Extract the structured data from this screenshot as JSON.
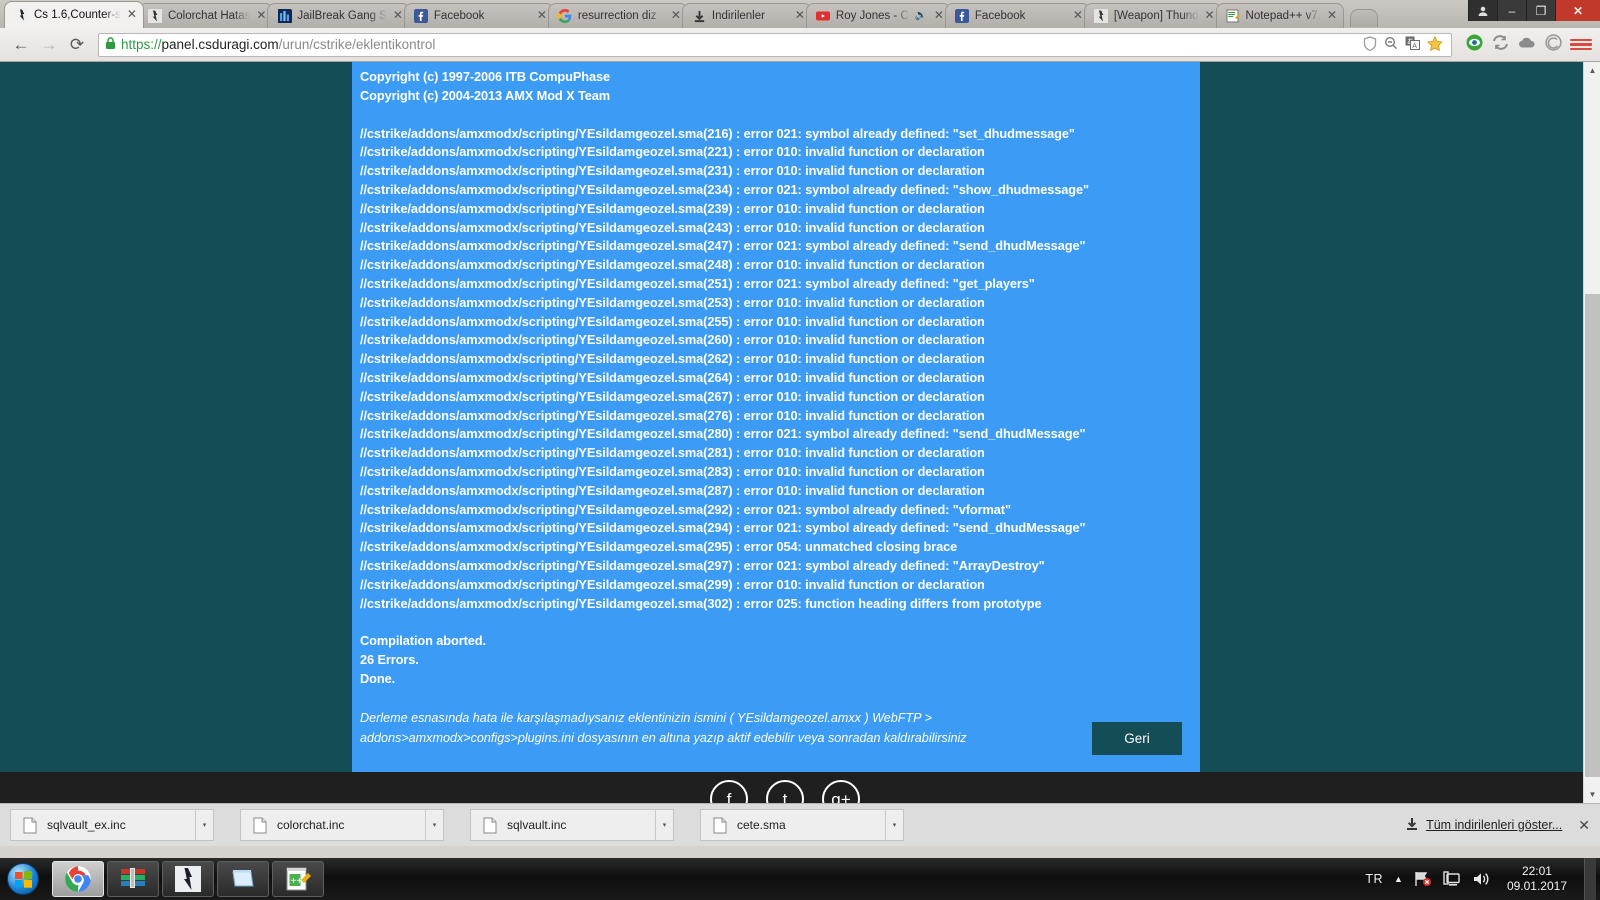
{
  "window": {
    "controls": {
      "user": "user-icon",
      "minimize": "–",
      "restore": "❐",
      "close": "✕"
    }
  },
  "tabs": [
    {
      "label": "Cs 1.6,Counter-s",
      "favicon": "cs-icon",
      "active": true,
      "close": "✕"
    },
    {
      "label": "Colorchat Hatas",
      "favicon": "cs-icon",
      "active": false,
      "close": "✕"
    },
    {
      "label": "JailBreak Gang S",
      "favicon": "forum-icon",
      "active": false,
      "close": "✕"
    },
    {
      "label": "Facebook",
      "favicon": "facebook-icon",
      "active": false,
      "close": "✕"
    },
    {
      "label": "resurrection diz",
      "favicon": "google-icon",
      "active": false,
      "close": "✕"
    },
    {
      "label": "İndirilenler",
      "favicon": "download-icon",
      "active": false,
      "close": "✕"
    },
    {
      "label": "Roy Jones - C",
      "favicon": "youtube-icon",
      "active": false,
      "close": "✕",
      "audio": "speaker-icon"
    },
    {
      "label": "Facebook",
      "favicon": "facebook-icon",
      "active": false,
      "close": "✕"
    },
    {
      "label": "[Weapon] Thund",
      "favicon": "cs-icon",
      "active": false,
      "close": "✕"
    },
    {
      "label": "Notepad++ v7.",
      "favicon": "notepad-icon",
      "active": false,
      "close": "✕"
    }
  ],
  "toolbar": {
    "back": "←",
    "forward": "→",
    "reload": "⟳",
    "lock": "lock-icon",
    "url_scheme": "https://",
    "url_host": "panel.csduragi.com",
    "url_path": "/urun/cstrike/eklentikontrol",
    "omnibox_icons": [
      "shield-icon",
      "zoom-out-icon",
      "translate-icon",
      "bookmark-star-icon"
    ],
    "extensions": [
      "adblock-icon",
      "sync-icon",
      "cloud-icon",
      "spiral-icon"
    ],
    "menu": "chrome-menu-icon"
  },
  "page": {
    "header_lines": [
      "Copyright (c) 1997-2006 ITB CompuPhase",
      "Copyright (c) 2004-2013 AMX Mod X Team"
    ],
    "errors": [
      "//cstrike/addons/amxmodx/scripting/YEsildamgeozel.sma(216) : error 021: symbol already defined: \"set_dhudmessage\"",
      "//cstrike/addons/amxmodx/scripting/YEsildamgeozel.sma(221) : error 010: invalid function or declaration",
      "//cstrike/addons/amxmodx/scripting/YEsildamgeozel.sma(231) : error 010: invalid function or declaration",
      "//cstrike/addons/amxmodx/scripting/YEsildamgeozel.sma(234) : error 021: symbol already defined: \"show_dhudmessage\"",
      "//cstrike/addons/amxmodx/scripting/YEsildamgeozel.sma(239) : error 010: invalid function or declaration",
      "//cstrike/addons/amxmodx/scripting/YEsildamgeozel.sma(243) : error 010: invalid function or declaration",
      "//cstrike/addons/amxmodx/scripting/YEsildamgeozel.sma(247) : error 021: symbol already defined: \"send_dhudMessage\"",
      "//cstrike/addons/amxmodx/scripting/YEsildamgeozel.sma(248) : error 010: invalid function or declaration",
      "//cstrike/addons/amxmodx/scripting/YEsildamgeozel.sma(251) : error 021: symbol already defined: \"get_players\"",
      "//cstrike/addons/amxmodx/scripting/YEsildamgeozel.sma(253) : error 010: invalid function or declaration",
      "//cstrike/addons/amxmodx/scripting/YEsildamgeozel.sma(255) : error 010: invalid function or declaration",
      "//cstrike/addons/amxmodx/scripting/YEsildamgeozel.sma(260) : error 010: invalid function or declaration",
      "//cstrike/addons/amxmodx/scripting/YEsildamgeozel.sma(262) : error 010: invalid function or declaration",
      "//cstrike/addons/amxmodx/scripting/YEsildamgeozel.sma(264) : error 010: invalid function or declaration",
      "//cstrike/addons/amxmodx/scripting/YEsildamgeozel.sma(267) : error 010: invalid function or declaration",
      "//cstrike/addons/amxmodx/scripting/YEsildamgeozel.sma(276) : error 010: invalid function or declaration",
      "//cstrike/addons/amxmodx/scripting/YEsildamgeozel.sma(280) : error 021: symbol already defined: \"send_dhudMessage\"",
      "//cstrike/addons/amxmodx/scripting/YEsildamgeozel.sma(281) : error 010: invalid function or declaration",
      "//cstrike/addons/amxmodx/scripting/YEsildamgeozel.sma(283) : error 010: invalid function or declaration",
      "//cstrike/addons/amxmodx/scripting/YEsildamgeozel.sma(287) : error 010: invalid function or declaration",
      "//cstrike/addons/amxmodx/scripting/YEsildamgeozel.sma(292) : error 021: symbol already defined: \"vformat\"",
      "//cstrike/addons/amxmodx/scripting/YEsildamgeozel.sma(294) : error 021: symbol already defined: \"send_dhudMessage\"",
      "//cstrike/addons/amxmodx/scripting/YEsildamgeozel.sma(295) : error 054: unmatched closing brace",
      "//cstrike/addons/amxmodx/scripting/YEsildamgeozel.sma(297) : error 021: symbol already defined: \"ArrayDestroy\"",
      "//cstrike/addons/amxmodx/scripting/YEsildamgeozel.sma(299) : error 010: invalid function or declaration",
      "//cstrike/addons/amxmodx/scripting/YEsildamgeozel.sma(302) : error 025: function heading differs from prototype"
    ],
    "summary_lines": [
      "Compilation aborted.",
      "26 Errors.",
      "Done."
    ],
    "note_line1": "Derleme esnasında hata ile karşılaşmadıysanız eklentinizin ismini ( YEsildamgeozel.amxx ) WebFTP >",
    "note_line2": "addons>amxmodx>configs>plugins.ini dosyasının en altına yazıp aktif edebilir veya sonradan kaldırabilirsiniz",
    "back_button": "Geri",
    "social_icons": [
      "facebook-icon",
      "twitter-icon",
      "google-plus-icon"
    ],
    "colors": {
      "page_background": "#144d55",
      "panel_background": "#3b9bf5",
      "button_background": "#144d55",
      "text": "#ffffff"
    }
  },
  "downloads": {
    "items": [
      {
        "name": "sqlvault_ex.inc",
        "caret": "▾"
      },
      {
        "name": "colorchat.inc",
        "caret": "▾"
      },
      {
        "name": "sqlvault.inc",
        "caret": "▾"
      },
      {
        "name": "cete.sma",
        "caret": "▾"
      }
    ],
    "show_all_label": "Tüm indirilenleri göster...",
    "close": "✕"
  },
  "taskbar": {
    "start": "windows-start-icon",
    "apps": [
      {
        "name": "chrome-taskbar-icon",
        "active": true
      },
      {
        "name": "winrar-taskbar-icon",
        "active": false
      },
      {
        "name": "counter-strike-taskbar-icon",
        "active": false
      },
      {
        "name": "notepad-taskbar-icon",
        "active": false
      },
      {
        "name": "notepadpp-taskbar-icon",
        "active": false
      }
    ],
    "tray": {
      "language": "TR",
      "show_hidden": "▲",
      "network": "network-error-icon",
      "display": "display-icon",
      "volume": "volume-icon",
      "time": "22:01",
      "date": "09.01.2017"
    }
  }
}
